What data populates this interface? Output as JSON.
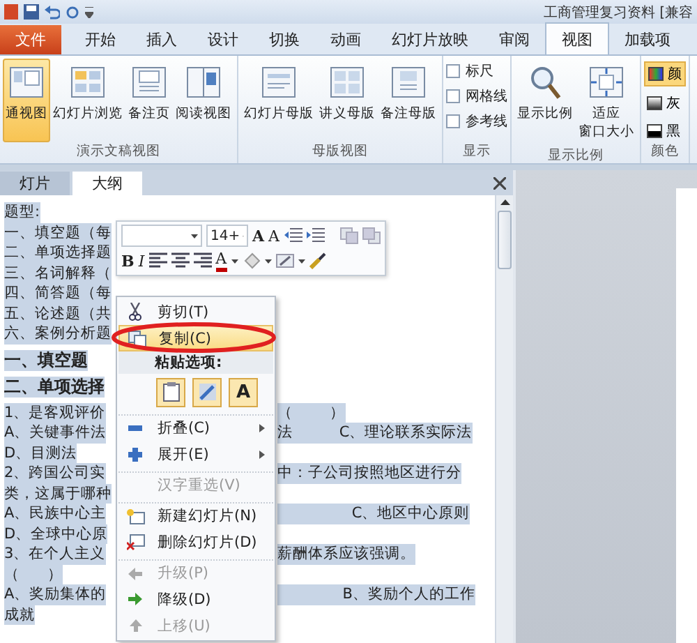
{
  "title_bar": {
    "title": "工商管理复习资料 [兼容"
  },
  "tabs": [
    {
      "label": "文件",
      "kind": "file",
      "selected": false
    },
    {
      "label": "开始",
      "kind": "tab",
      "selected": false
    },
    {
      "label": "插入",
      "kind": "tab",
      "selected": false
    },
    {
      "label": "设计",
      "kind": "tab",
      "selected": false
    },
    {
      "label": "切换",
      "kind": "tab",
      "selected": false
    },
    {
      "label": "动画",
      "kind": "tab",
      "selected": false
    },
    {
      "label": "幻灯片放映",
      "kind": "tab",
      "selected": false
    },
    {
      "label": "审阅",
      "kind": "tab",
      "selected": false
    },
    {
      "label": "视图",
      "kind": "tab",
      "selected": true
    },
    {
      "label": "加载项",
      "kind": "tab",
      "selected": false
    }
  ],
  "ribbon": [
    {
      "label": "演示文稿视图",
      "items": [
        {
          "kind": "normal",
          "label": "通视图",
          "selected": true
        },
        {
          "kind": "sorter",
          "label": "幻灯片浏览",
          "selected": false
        },
        {
          "kind": "notes",
          "label": "备注页",
          "selected": false
        },
        {
          "kind": "reading",
          "label": "阅读视图",
          "selected": false
        }
      ]
    },
    {
      "label": "母版视图",
      "items": [
        {
          "kind": "slide-master",
          "label": "幻灯片母版",
          "selected": false
        },
        {
          "kind": "handout",
          "label": "讲义母版",
          "selected": false
        },
        {
          "kind": "notes-master",
          "label": "备注母版",
          "selected": false
        }
      ]
    },
    {
      "label": "显示",
      "items": [
        {
          "kind": "check",
          "label": "标尺",
          "checked": false
        },
        {
          "kind": "check",
          "label": "网格线",
          "checked": false
        },
        {
          "kind": "check",
          "label": "参考线",
          "checked": false
        }
      ]
    },
    {
      "label": "显示比例",
      "items": [
        {
          "kind": "zoom",
          "label": "显示比例",
          "selected": false
        },
        {
          "kind": "fit",
          "label": "适应窗口大小",
          "selected": false
        }
      ]
    },
    {
      "label": "颜色",
      "items": [
        {
          "kind": "color",
          "label": "颜",
          "selected": true
        },
        {
          "kind": "gray",
          "label": "灰",
          "selected": false
        },
        {
          "kind": "bw",
          "label": "黑",
          "selected": false
        }
      ]
    }
  ],
  "pane_tabs": [
    {
      "label": "灯片",
      "selected": false
    },
    {
      "label": "大纲",
      "selected": true
    }
  ],
  "outline": [
    {
      "left": "题型:",
      "bold": false,
      "selected": true
    },
    {
      "left": "一、填空题（每",
      "bold": false,
      "selected": true
    },
    {
      "left": "二、单项选择题",
      "bold": false,
      "selected": true
    },
    {
      "left": "三、名词解释（",
      "bold": false,
      "selected": true
    },
    {
      "left": "四、简答题（每",
      "bold": false,
      "selected": true
    },
    {
      "left": "五、论述题（共",
      "bold": false,
      "selected": true
    },
    {
      "left": "六、案例分析题",
      "bold": false,
      "selected": true
    },
    {
      "left": "一、填空题",
      "bold": true,
      "selected": true
    },
    {
      "left": "二、单项选择",
      "bold": true,
      "selected": true
    },
    {
      "left": "1、是客观评价",
      "right": "（        ）",
      "bold": false,
      "selected": true
    },
    {
      "left": "A、关键事件法",
      "right": "法          C、理论联系实际法",
      "bold": false,
      "selected": true
    },
    {
      "left": "D、目测法",
      "bold": false,
      "selected": true
    },
    {
      "left": "2、跨国公司实",
      "right": "中：子公司按照地区进行分",
      "bold": false,
      "selected": true
    },
    {
      "left": "类，这属于哪种",
      "bold": false,
      "selected": true
    },
    {
      "left": "A、民族中心主",
      "right": "                C、地区中心原则",
      "bold": false,
      "selected": true
    },
    {
      "left": "D、全球中心原",
      "bold": false,
      "selected": true
    },
    {
      "left": "3、在个人主义",
      "right": "薪酬体系应该强调。",
      "bold": false,
      "selected": true
    },
    {
      "left": "（      ）",
      "bold": false,
      "selected": true
    },
    {
      "left": "A、奖励集体的",
      "right": "              B、奖励个人的工作",
      "bold": false,
      "selected": true
    },
    {
      "left": "成就",
      "bold": false,
      "selected": true
    }
  ],
  "mini_toolbar": {
    "font_size": "14+",
    "grow_font": "A",
    "shrink_font": "A",
    "bold": "B",
    "italic": "I",
    "font_color": "A"
  },
  "context_menu": [
    {
      "kind": "cut",
      "label": "剪切(T)",
      "submenu": false,
      "selected": false,
      "disabled": false,
      "group_start": false
    },
    {
      "kind": "copy",
      "label": "复制(C)",
      "submenu": false,
      "selected": true,
      "disabled": false,
      "group_start": false
    },
    {
      "kind": "header",
      "label": "粘贴选项:"
    },
    {
      "kind": "paste-row",
      "text_option": "A"
    },
    {
      "kind": "collapse",
      "label": "折叠(C)",
      "submenu": true,
      "selected": false,
      "disabled": false,
      "group_start": true
    },
    {
      "kind": "expand",
      "label": "展开(E)",
      "submenu": true,
      "selected": false,
      "disabled": false,
      "group_start": false
    },
    {
      "kind": "reselect",
      "label": "汉字重选(V)",
      "submenu": false,
      "selected": false,
      "disabled": true,
      "group_start": true
    },
    {
      "kind": "new-slide",
      "label": "新建幻灯片(N)",
      "submenu": false,
      "selected": false,
      "disabled": false,
      "group_start": true
    },
    {
      "kind": "delete-slide",
      "label": "删除幻灯片(D)",
      "submenu": false,
      "selected": false,
      "disabled": false,
      "group_start": false
    },
    {
      "kind": "promote",
      "label": "升级(P)",
      "submenu": false,
      "selected": false,
      "disabled": true,
      "group_start": true
    },
    {
      "kind": "demote",
      "label": "降级(D)",
      "submenu": false,
      "selected": false,
      "disabled": false,
      "group_start": false
    },
    {
      "kind": "move-up",
      "label": "上移(U)",
      "submenu": false,
      "selected": false,
      "disabled": true,
      "group_start": false
    }
  ]
}
